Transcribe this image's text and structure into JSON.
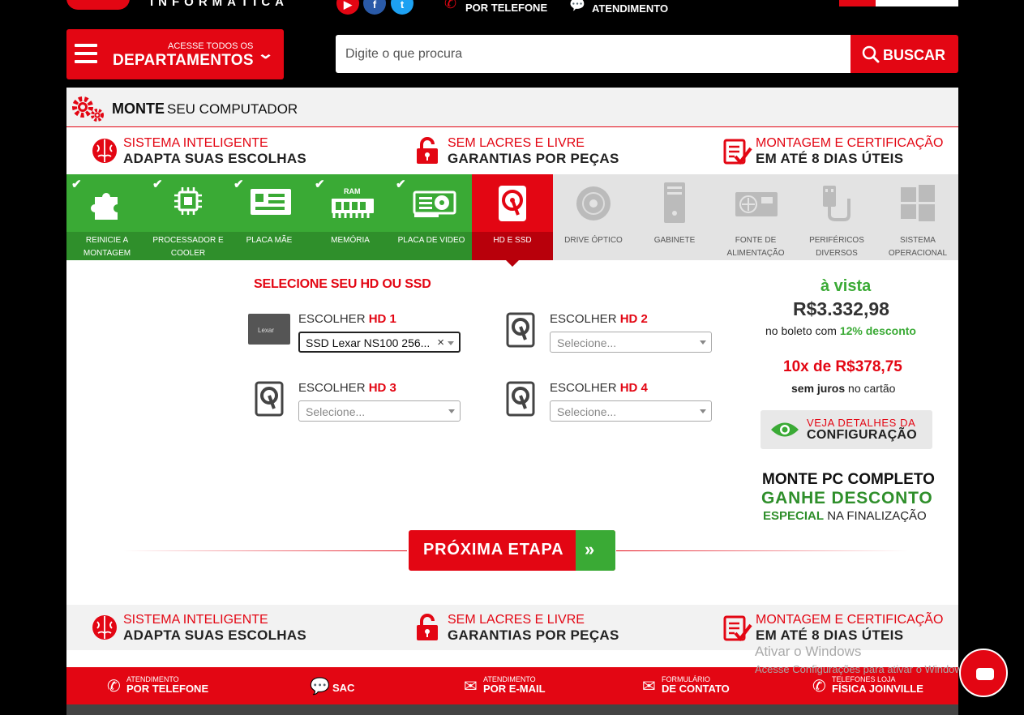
{
  "header": {
    "logo_text": "INFORMÁTICA",
    "top_phone": "POR TELEFONE",
    "top_atendimento": "ATENDIMENTO",
    "social": [
      "youtube",
      "facebook",
      "twitter"
    ],
    "dept_small": "ACESSE TODOS OS",
    "dept_big": "DEPARTAMENTOS",
    "search_placeholder": "Digite o que procura",
    "search_button": "BUSCAR"
  },
  "title": {
    "strong": "MONTE",
    "rest": "SEU COMPUTADOR"
  },
  "features": [
    {
      "l1": "SISTEMA INTELIGENTE",
      "l2": "ADAPTA SUAS ESCOLHAS",
      "icon": "brain-icon"
    },
    {
      "l1": "SEM LACRES E LIVRE",
      "l2": "GARANTIAS POR PEÇAS",
      "icon": "lock-icon"
    },
    {
      "l1": "MONTAGEM E CERTIFICAÇÃO",
      "l2": "EM ATÉ 8 DIAS ÚTEIS",
      "icon": "checklist-icon"
    }
  ],
  "steps": [
    {
      "label1": "REINICIE A",
      "label2": "MONTAGEM",
      "state": "done"
    },
    {
      "label1": "PROCESSADOR E",
      "label2": "COOLER",
      "state": "done"
    },
    {
      "label1": "PLACA MÃE",
      "label2": "",
      "state": "done"
    },
    {
      "label1": "MEMÓRIA",
      "label2": "",
      "state": "done",
      "badge": "RAM"
    },
    {
      "label1": "PLACA DE VIDEO",
      "label2": "",
      "state": "done"
    },
    {
      "label1": "HD E SSD",
      "label2": "",
      "state": "active"
    },
    {
      "label1": "DRIVE ÓPTICO",
      "label2": "",
      "state": "todo"
    },
    {
      "label1": "GABINETE",
      "label2": "",
      "state": "todo"
    },
    {
      "label1": "FONTE DE",
      "label2": "ALIMENTAÇÃO",
      "state": "todo"
    },
    {
      "label1": "PERIFÉRICOS",
      "label2": "DIVERSOS",
      "state": "todo"
    },
    {
      "label1": "SISTEMA",
      "label2": "OPERACIONAL",
      "state": "todo"
    }
  ],
  "selection": {
    "title": "SELECIONE SEU HD OU SSD",
    "choose": "ESCOLHER",
    "thumb_brand": "Lexar",
    "slots": [
      {
        "hd": "HD 1",
        "value": "SSD Lexar NS100 256...",
        "selected": true
      },
      {
        "hd": "HD 2",
        "value": "Selecione...",
        "selected": false
      },
      {
        "hd": "HD 3",
        "value": "Selecione...",
        "selected": false
      },
      {
        "hd": "HD 4",
        "value": "Selecione...",
        "selected": false
      }
    ]
  },
  "price": {
    "avista": "à vista",
    "value": "R$3.332,98",
    "boleto_prefix": "no boleto com",
    "boleto_discount": "12% desconto",
    "installments": "10x de R$378,75",
    "juros_bold": "sem juros",
    "juros_rest": "no cartão",
    "details_l1": "VEJA DETALHES DA",
    "details_l2": "CONFIGURAÇÃO",
    "promo1": "MONTE PC COMPLETO",
    "promo2": "GANHE DESCONTO",
    "promo3_green": "ESPECIAL",
    "promo3_rest": "NA FINALIZAÇÃO"
  },
  "next_button": "PRÓXIMA ETAPA",
  "footer": {
    "items": [
      {
        "s": "ATENDIMENTO",
        "b": "POR TELEFONE"
      },
      {
        "s": "",
        "b": "SAC"
      },
      {
        "s": "ATENDIMENTO",
        "b": "POR E-MAIL"
      },
      {
        "s": "FORMULÁRIO",
        "b": "DE CONTATO"
      },
      {
        "s": "TELEFONES LOJA",
        "b": "FÍSICA JOINVILLE"
      }
    ]
  },
  "watermark": {
    "l1": "Ativar o Windows",
    "l2": "Acesse Configurações para ativar o Windows."
  },
  "colors": {
    "brand_red": "#e30613",
    "green": "#3aaa35",
    "dark_green": "#2f8f2b"
  }
}
